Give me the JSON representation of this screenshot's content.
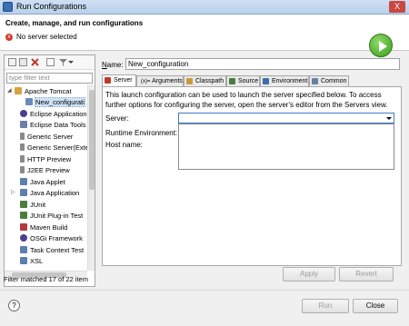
{
  "window": {
    "title": "Run Configurations",
    "close_glyph": "X"
  },
  "header": {
    "title": "Create, manage, and run configurations",
    "message": "No server selected",
    "error_glyph": "x"
  },
  "left": {
    "filter_placeholder": "type filter text",
    "items": [
      {
        "label": "Apache Tomcat",
        "icon": "tomcat-icon",
        "color": "#d8a23c",
        "expanded": true
      },
      {
        "label": "New_configurati",
        "icon": "server-config-icon",
        "color": "#6c8bb8",
        "selected": true
      },
      {
        "label": "Eclipse Application",
        "icon": "eclipse-icon",
        "color": "#4b3f8f"
      },
      {
        "label": "Eclipse Data Tools",
        "icon": "data-tools-icon",
        "color": "#6a7fa6"
      },
      {
        "label": "Generic Server",
        "icon": "generic-server-icon",
        "color": "#8a8a8a"
      },
      {
        "label": "Generic Server(Exter",
        "icon": "generic-server-icon",
        "color": "#8a8a8a"
      },
      {
        "label": "HTTP Preview",
        "icon": "http-preview-icon",
        "color": "#8a8a8a"
      },
      {
        "label": "J2EE Preview",
        "icon": "j2ee-preview-icon",
        "color": "#8a8a8a"
      },
      {
        "label": "Java Applet",
        "icon": "java-applet-icon",
        "color": "#5a7fb0"
      },
      {
        "label": "Java Application",
        "icon": "java-app-icon",
        "color": "#5a7fb0",
        "collapsed": true
      },
      {
        "label": "JUnit",
        "icon": "junit-icon",
        "color": "#4d7d3c"
      },
      {
        "label": "JUnit Plug-in Test",
        "icon": "junit-plugin-icon",
        "color": "#4d7d3c"
      },
      {
        "label": "Maven Build",
        "icon": "maven-icon",
        "color": "#b73a3a"
      },
      {
        "label": "OSGi Framework",
        "icon": "osgi-icon",
        "color": "#4b3f8f"
      },
      {
        "label": "Task Context Test",
        "icon": "task-context-icon",
        "color": "#5a7fb0"
      },
      {
        "label": "XSL",
        "icon": "xsl-icon",
        "color": "#5a7fb0"
      }
    ],
    "filter_status": "Filter matched 17 of 22 item"
  },
  "right": {
    "name_label_prefix": "N",
    "name_label_rest": "ame:",
    "name_value": "New_configuration",
    "tabs": [
      {
        "label": "Server",
        "icon": "server-tab-icon",
        "color": "#c0392b",
        "active": true
      },
      {
        "label": "Arguments",
        "icon": "arguments-tab-icon",
        "color": "#555555",
        "prefix": "(x)="
      },
      {
        "label": "Classpath",
        "icon": "classpath-tab-icon",
        "color": "#c89a3a"
      },
      {
        "label": "Source",
        "icon": "source-tab-icon",
        "color": "#4d7d3c"
      },
      {
        "label": "Environment",
        "icon": "environment-tab-icon",
        "color": "#3a6fb0"
      },
      {
        "label": "Common",
        "icon": "common-tab-icon",
        "color": "#6a7fa6"
      }
    ],
    "description": "This launch configuration can be used to launch the server specified below. To access further options for configuring the server, open the server's editor from the Servers view.",
    "server_label": "Server:",
    "runtime_label": "Runtime Environment:",
    "host_label": "Host name:",
    "apply_label": "Apply",
    "revert_label": "Revert"
  },
  "footer": {
    "help_glyph": "?",
    "run_label": "Run",
    "close_label": "Close"
  }
}
